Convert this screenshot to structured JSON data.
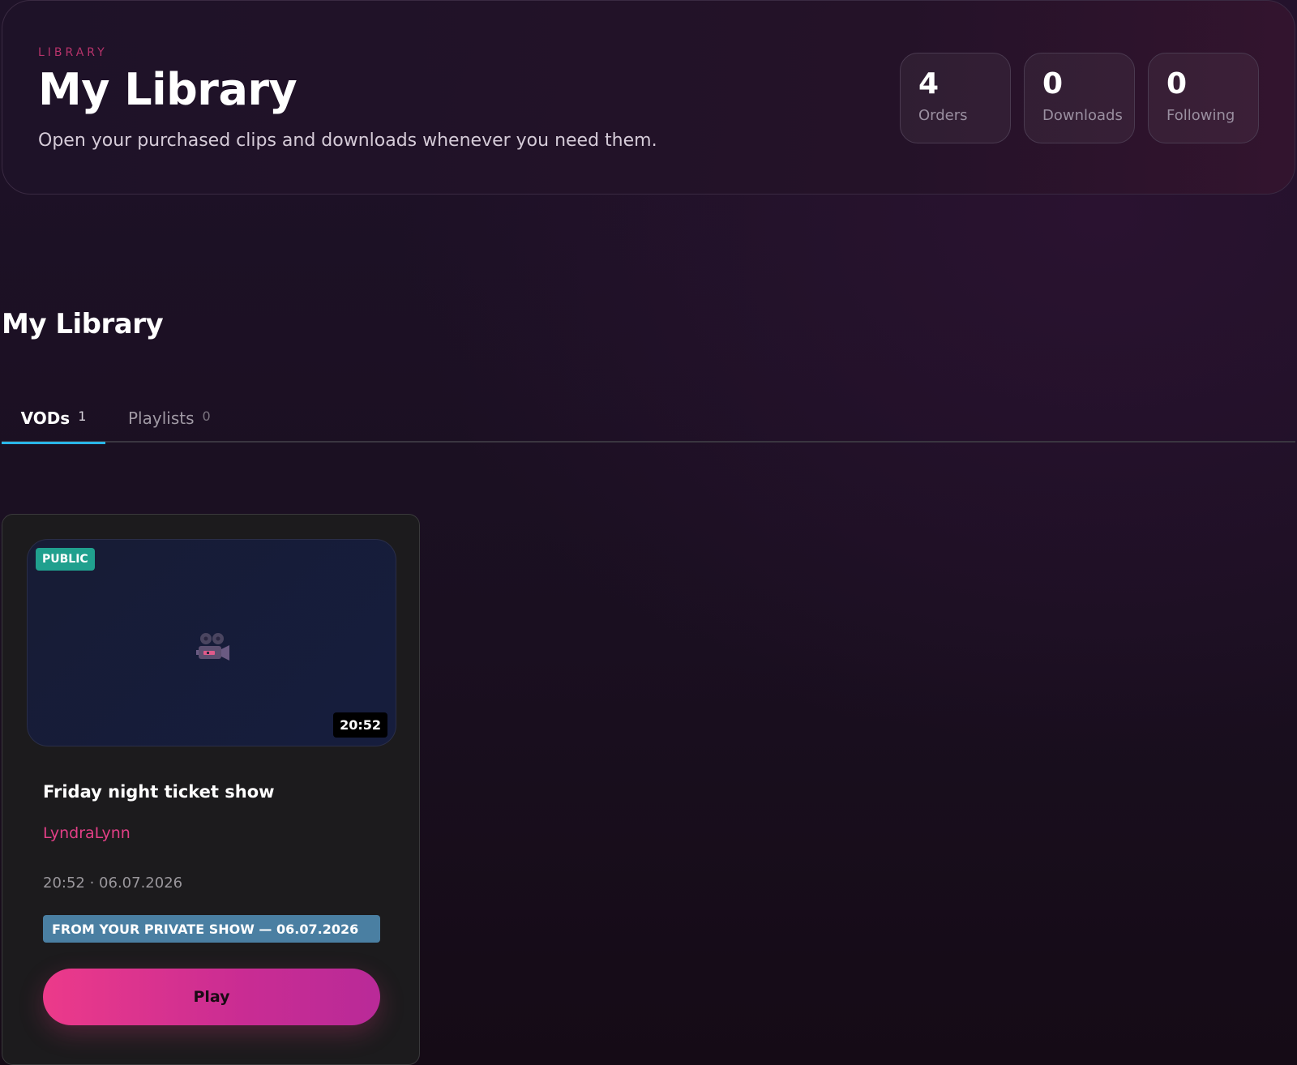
{
  "hero": {
    "eyebrow": "LIBRARY",
    "title": "My Library",
    "subtitle": "Open your purchased clips and downloads whenever you need them.",
    "stats": [
      {
        "value": "4",
        "label": "Orders"
      },
      {
        "value": "0",
        "label": "Downloads"
      },
      {
        "value": "0",
        "label": "Following"
      }
    ]
  },
  "section": {
    "title": "My Library"
  },
  "tabs": [
    {
      "label": "VODs",
      "count": "1",
      "active": true
    },
    {
      "label": "Playlists",
      "count": "0",
      "active": false
    }
  ],
  "vods": [
    {
      "visibility": "PUBLIC",
      "duration": "20:52",
      "title": "Friday night ticket show",
      "creator": "LyndraLynn",
      "meta": "20:52 · 06.07.2026",
      "tag": "FROM YOUR PRIVATE SHOW — 06.07.2026",
      "play_label": "Play",
      "thumbnail_icon": "movie-camera-icon"
    }
  ],
  "colors": {
    "accent_pink": "#e23f86",
    "tab_indicator": "#2ab6e8",
    "public_badge": "#20a08e",
    "tag_bg": "#4a7fa2"
  }
}
